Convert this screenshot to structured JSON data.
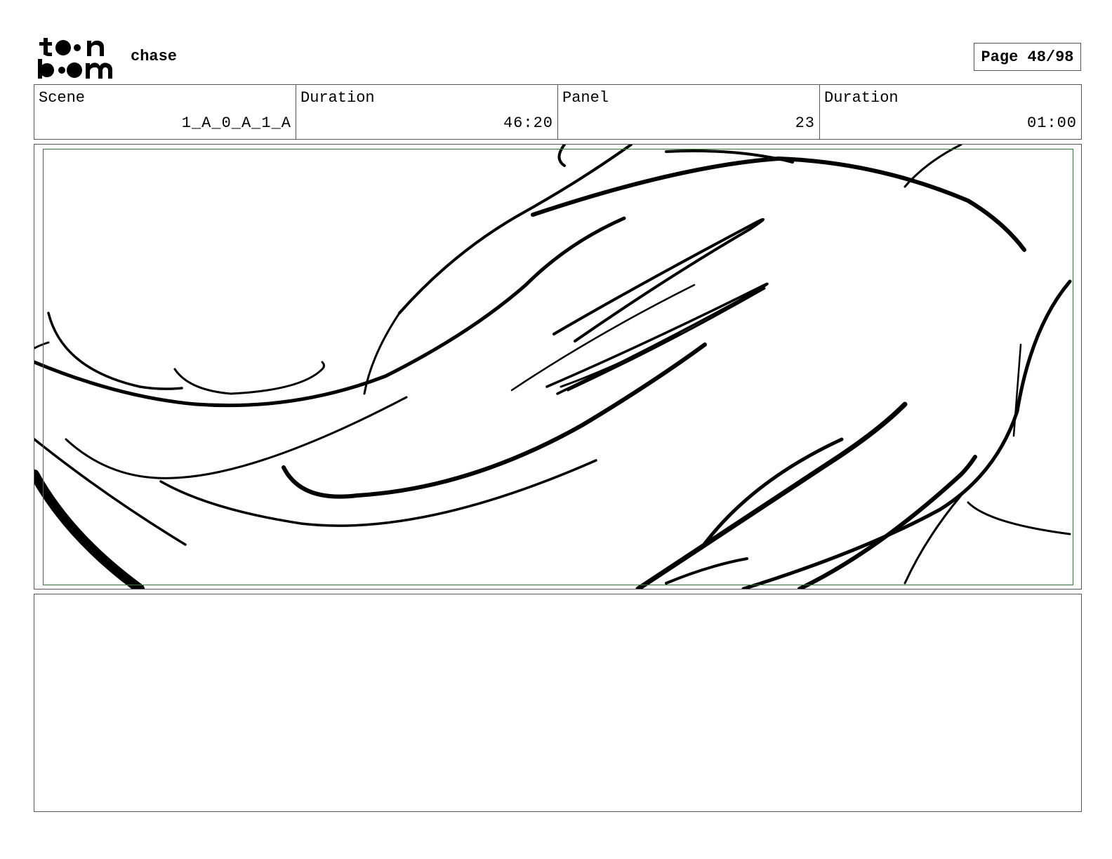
{
  "header": {
    "logo_text": "toon boom",
    "project_title": "chase",
    "page_label": "Page 48/98"
  },
  "info": {
    "scene_label": "Scene",
    "scene_value": "1_A_0_A_1_A",
    "scene_duration_label": "Duration",
    "scene_duration_value": "46:20",
    "panel_label": "Panel",
    "panel_value": "23",
    "panel_duration_label": "Duration",
    "panel_duration_value": "01:00"
  },
  "panel": {
    "drawing_description": "rough ink sketch of flowing hair strands",
    "safe_frame_color": "#2f7d32"
  },
  "notes": {
    "text": ""
  }
}
